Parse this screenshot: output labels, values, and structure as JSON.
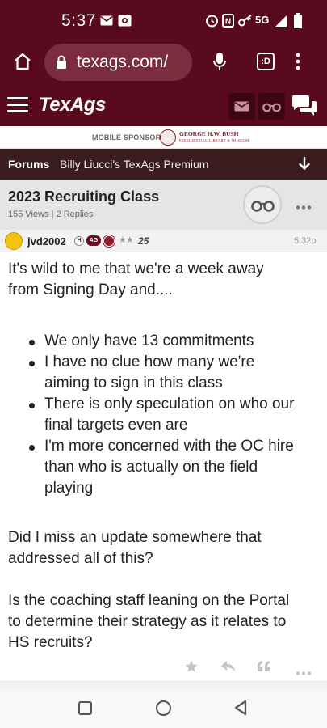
{
  "status_bar": {
    "time": "5:37",
    "network": "5G",
    "icons": [
      "mail-icon",
      "camera-icon",
      "alarm-icon",
      "nfc-icon",
      "key-icon",
      "signal-icon",
      "battery-icon"
    ]
  },
  "browser": {
    "url": "texags.com/",
    "tab_switcher_label": ":D"
  },
  "site": {
    "logo": "TexAgs"
  },
  "sponsor": {
    "label": "MOBILE SPONSOR",
    "name": "GEORGE H.W. BUSH",
    "subtitle": "PRESIDENTIAL LIBRARY & MUSEUM"
  },
  "forum_bar": {
    "label": "Forums",
    "forum_name": "Billy Liucci's TexAgs Premium"
  },
  "thread": {
    "title": "2023 Recruiting Class",
    "meta": "155 Views | 2 Replies"
  },
  "post": {
    "username": "jvd2002",
    "badge_h": "H",
    "badge_ag": "AG",
    "stars": "★★",
    "rank": "25",
    "time": "5:32p",
    "lines": [
      "It's wild to me that we're a week away",
      "from Signing Day and...."
    ],
    "bullets": [
      [
        "We only have 13 commitments"
      ],
      [
        "I have no clue how many we're",
        "aiming to sign in this class"
      ],
      [
        "There is only speculation on who our",
        "final targets even are"
      ],
      [
        "I'm more concerned with the OC hire",
        "than who is actually on the field",
        "playing"
      ]
    ],
    "closing": [
      "Did I miss an update somewhere that",
      "addressed all of this?",
      "",
      "Is the coaching staff leaning on the Portal",
      "to determine their strategy as it relates to",
      "HS recruits?"
    ]
  },
  "colors": {
    "brand": "#5a0a1e",
    "forum_bar": "#3a1c1f",
    "thread_header": "#e5e5e5"
  }
}
